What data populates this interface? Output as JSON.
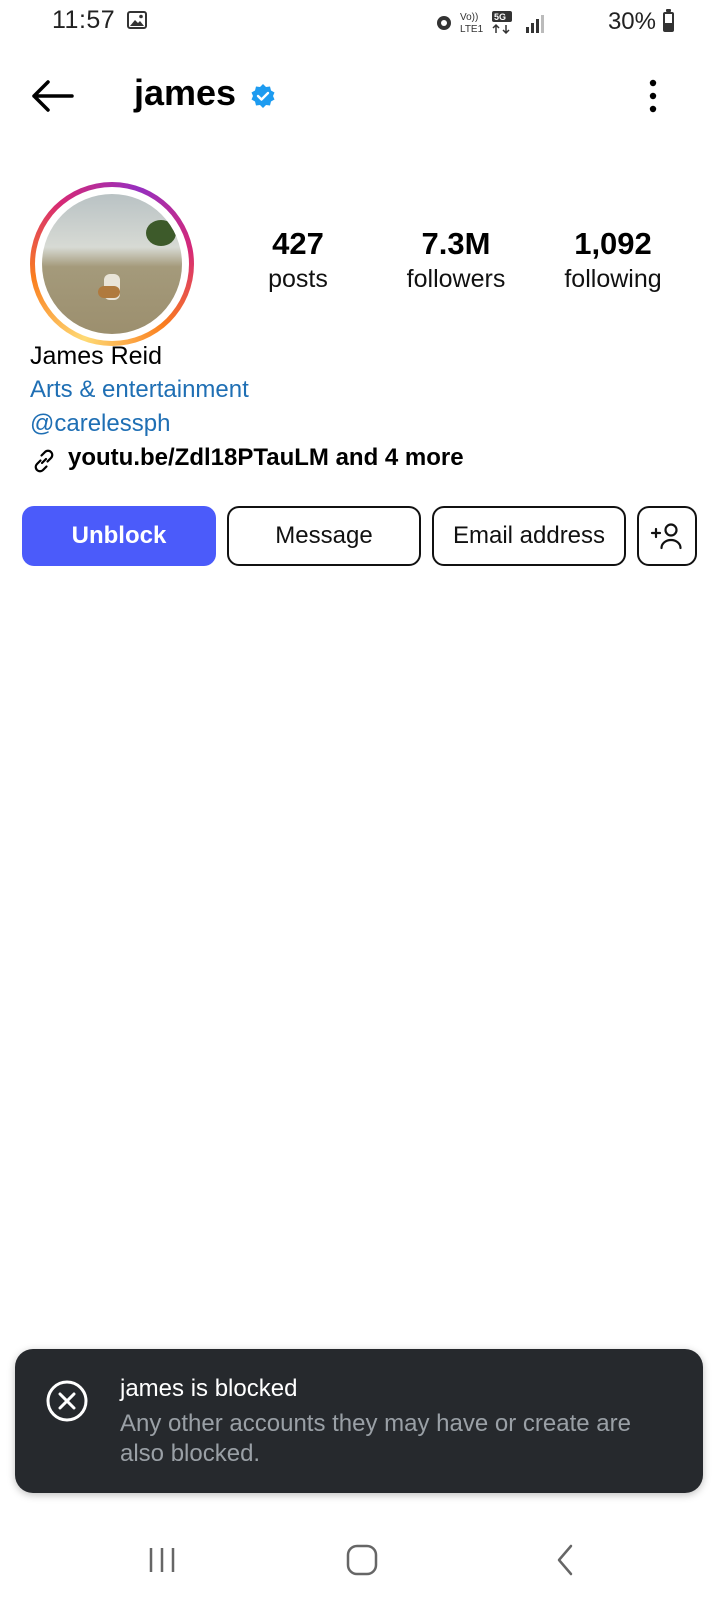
{
  "status_bar": {
    "time": "11:57",
    "network": "Vo)) LTE1 5G",
    "battery": "30%",
    "icons": [
      "gallery-icon",
      "alarm-icon",
      "volte-icon",
      "5g-icon",
      "signal-icon",
      "battery-icon"
    ]
  },
  "header": {
    "username": "james",
    "verified": true,
    "back_icon": "arrow-left-icon",
    "more_icon": "more-vertical-icon"
  },
  "profile": {
    "stats": [
      {
        "value": "427",
        "label": "posts"
      },
      {
        "value": "7.3M",
        "label": "followers"
      },
      {
        "value": "1,092",
        "label": "following"
      }
    ],
    "full_name": "James Reid",
    "category": "Arts & entertainment",
    "handle": "@carelessph",
    "link": "youtu.be/Zdl18PTauLM and 4 more",
    "link_icon": "link-icon"
  },
  "actions": {
    "unblock": "Unblock",
    "message": "Message",
    "email": "Email address",
    "add_user_icon": "add-user-icon"
  },
  "toast": {
    "title": "james is blocked",
    "body": "Any other accounts they may have or create are also blocked.",
    "icon": "close-circle-icon"
  },
  "bottom_nav": [
    "home-icon",
    "search-icon",
    "create-icon",
    "reels-icon",
    "profile-icon"
  ],
  "system_nav": [
    "recent-apps-icon",
    "home-button-icon",
    "back-icon"
  ],
  "colors": {
    "primary_button": "#4b5bfa",
    "link_blue": "#1f6fb4",
    "verified_blue": "#1d9bf0",
    "toast_bg": "#26292d"
  }
}
